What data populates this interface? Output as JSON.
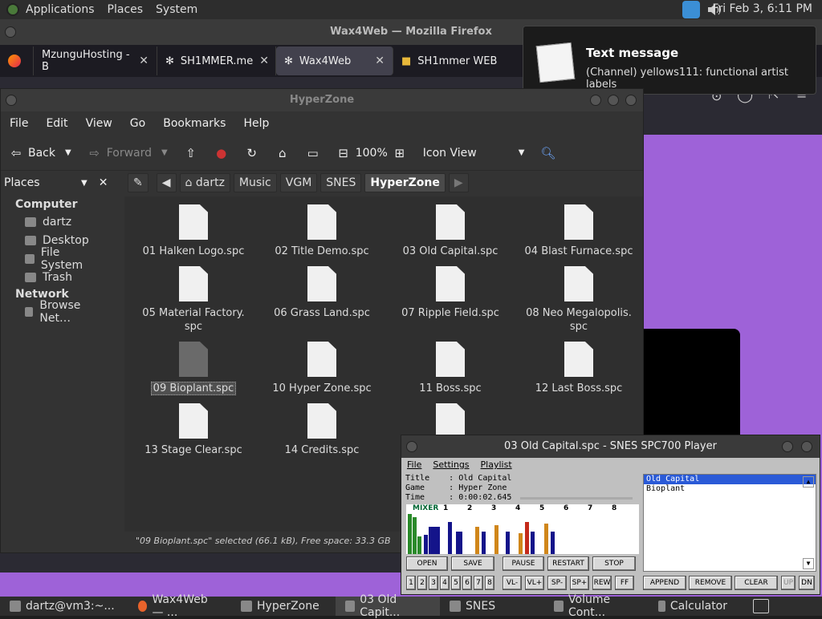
{
  "top_panel": {
    "menus": [
      "Applications",
      "Places",
      "System"
    ],
    "clock": "Fri Feb  3,  6:11 PM"
  },
  "firefox": {
    "title": "Wax4Web — Mozilla Firefox",
    "tabs": [
      {
        "label": "MzunguHosting - B",
        "active": false
      },
      {
        "label": "SH1MMER.me",
        "active": false
      },
      {
        "label": "Wax4Web",
        "active": true
      },
      {
        "label": "SH1mmer WEB",
        "active": false
      }
    ],
    "accent": "#9e62d8"
  },
  "notification": {
    "title": "Text message",
    "body": "(Channel) yellows111: functional artist labels"
  },
  "nautilus": {
    "title": "HyperZone",
    "menu": [
      "File",
      "Edit",
      "View",
      "Go",
      "Bookmarks",
      "Help"
    ],
    "toolbar": {
      "back": "Back",
      "forward": "Forward",
      "zoom": "100%",
      "view_mode": "Icon View"
    },
    "sidebar": {
      "header": "Places",
      "sections": [
        {
          "title": "Computer",
          "items": [
            "dartz",
            "Desktop",
            "File System",
            "Trash"
          ]
        },
        {
          "title": "Network",
          "items": [
            "Browse Net…"
          ]
        }
      ]
    },
    "path": [
      "dartz",
      "Music",
      "VGM",
      "SNES",
      "HyperZone"
    ],
    "files": [
      "01 Halken Logo.spc",
      "02 Title Demo.spc",
      "03 Old Capital.spc",
      "04 Blast Furnace.spc",
      "05 Material Factory.\nspc",
      "06 Grass Land.spc",
      "07 Ripple Field.spc",
      "08 Neo Megalopolis.\nspc",
      "09 Bioplant.spc",
      "10 Hyper Zone.spc",
      "11 Boss.spc",
      "12 Last Boss.spc",
      "13 Stage Clear.spc",
      "14 Credits.spc"
    ],
    "selected_file": "09 Bioplant.spc",
    "status": "\"09 Bioplant.spc\" selected (66.1 kB), Free space: 33.3 GB"
  },
  "player": {
    "title": "03 Old Capital.spc - SNES SPC700 Player",
    "menu": [
      "File",
      "Settings",
      "Playlist"
    ],
    "info": "Title    : Old Capital\nGame     : Hyper Zone\nTime     : 0:00:02.645",
    "mixer_label": "MIXER",
    "channels": [
      "1",
      "2",
      "3",
      "4",
      "5",
      "6",
      "7",
      "8"
    ],
    "buttons_row1": [
      "OPEN",
      "SAVE",
      "PAUSE",
      "RESTART",
      "STOP"
    ],
    "buttons_row2": [
      "VL-",
      "VL+",
      "SP-",
      "SP+",
      "REW",
      "FF"
    ],
    "channel_toggles": [
      "1",
      "2",
      "3",
      "4",
      "5",
      "6",
      "7",
      "8"
    ],
    "playlist_buttons": [
      "APPEND",
      "REMOVE",
      "CLEAR",
      "UP",
      "DN"
    ],
    "playlist": [
      "Old Capital",
      "Bioplant"
    ],
    "playlist_selected": "Old Capital"
  },
  "taskbar": {
    "tasks": [
      {
        "label": "dartz@vm3:~...",
        "active": false
      },
      {
        "label": "Wax4Web — ...",
        "active": false
      },
      {
        "label": "HyperZone",
        "active": false
      },
      {
        "label": "03 Old Capit...",
        "active": true
      },
      {
        "label": "SNES",
        "active": false
      },
      {
        "label": "Volume Cont...",
        "active": false
      },
      {
        "label": "Calculator",
        "active": false
      }
    ]
  }
}
